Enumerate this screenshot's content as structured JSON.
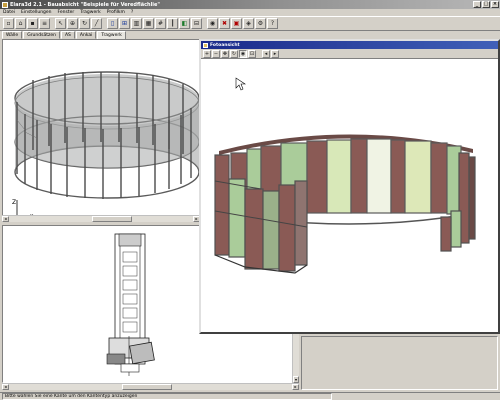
{
  "window": {
    "title": "Elara3d 2.1 - Bauabsicht \"Beispiele für Veredflächlie\"",
    "minimize": "_",
    "maximize": "□",
    "close": "×"
  },
  "menu": [
    "Datei",
    "Einstellungen",
    "Fenster",
    "Tragwerk",
    "Profilkm",
    "?"
  ],
  "toolbar": {
    "icons": [
      "new-icon",
      "open-icon",
      "save-icon",
      "print-icon",
      "arrow-icon",
      "zoom-icon",
      "rotate-icon",
      "line-icon",
      "door-icon",
      "window-icon",
      "panel-icon",
      "frame-icon",
      "grid-icon",
      "profile-icon",
      "glass-icon",
      "section-icon",
      "camera-icon",
      "red-x-icon",
      "layer-icon",
      "render-icon",
      "settings-icon",
      "help-icon"
    ]
  },
  "tabs": [
    "Wälle",
    "Grundsätzen",
    "AS",
    "Ankai",
    "Tragwerk"
  ],
  "active_tab": 4,
  "axis": {
    "z": "Z",
    "x": "X"
  },
  "foto_window": {
    "title": "Fotoansicht",
    "tools": [
      "zoom-in-icon",
      "zoom-out-icon",
      "pan-icon",
      "rotate-icon",
      "eye-icon",
      "fit-icon",
      "prev-icon",
      "next-icon"
    ]
  },
  "status": {
    "text": "Bitte wählen Sie eine Kante um den Kantentyp anzuzeigen"
  },
  "colors": {
    "frame": "#5a5a5a",
    "glass": "#8f9090",
    "brown_panel": "#8a5a55",
    "green_panel": "#aacc9a",
    "light_panel": "#e8ecd0",
    "title_blue": "#1a2a8a"
  }
}
